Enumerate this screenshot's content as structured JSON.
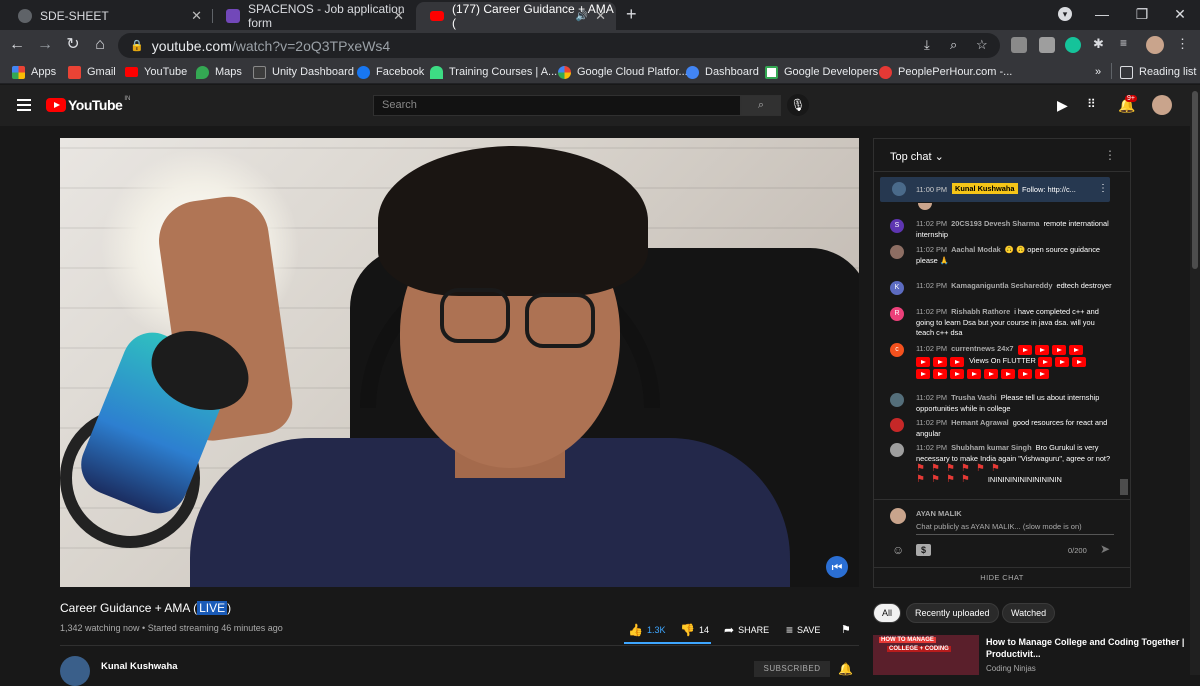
{
  "browser": {
    "tabs": [
      {
        "title": "SDE-SHEET",
        "active": false
      },
      {
        "title": "SPACENOS - Job application form",
        "active": false
      },
      {
        "title": "(177) Career Guidance + AMA (",
        "active": true
      }
    ],
    "url_host": "youtube.com",
    "url_path": "/watch?v=2oQ3TPxeWs4",
    "bookmarks": [
      "Apps",
      "Gmail",
      "YouTube",
      "Maps",
      "Unity Dashboard",
      "Facebook",
      "Training Courses | A...",
      "Google Cloud Platfor...",
      "Dashboard",
      "Google Developers",
      "PeoplePerHour.com -..."
    ],
    "more_bookmarks": "»",
    "reading_list": "Reading list"
  },
  "youtube": {
    "logo_text": "YouTube",
    "country_code": "IN",
    "search_placeholder": "Search",
    "notifications": "9+"
  },
  "video": {
    "title_prefix": "Career Guidance + AMA (",
    "title_live": "LIVE",
    "title_suffix": ")",
    "meta": "1,342 watching now • Started streaming 46 minutes ago",
    "likes": "1.3K",
    "dislikes": "14",
    "share_label": "SHARE",
    "save_label": "SAVE",
    "channel_name": "Kunal Kushwaha",
    "subscribed_label": "SUBSCRIBED"
  },
  "chat": {
    "title": "Top chat",
    "pinned": {
      "time": "11:00 PM",
      "author": "Kunal Kushwaha",
      "text": "Follow: http://c..."
    },
    "messages": [
      {
        "time": "11:02 PM",
        "author": "20CS193 Devesh Sharma",
        "text": "remote international internship",
        "avatar": "S",
        "color": "#5e35b1"
      },
      {
        "time": "11:02 PM",
        "author": "Aachal Modak",
        "text": "🙃 🙃 open source guidance please 🙏",
        "avatar": "",
        "color": "#8d6e63"
      },
      {
        "time": "11:02 PM",
        "author": "Kamaganiguntla Seshareddy",
        "text": "edtech destroyer",
        "avatar": "K",
        "color": "#5c6bc0"
      },
      {
        "time": "11:02 PM",
        "author": "Rishabh Rathore",
        "text": "i have completed c++ and going to learn Dsa but your course in java dsa. will you teach c++ dsa",
        "avatar": "R",
        "color": "#ec407a"
      },
      {
        "time": "11:02 PM",
        "author": "currentnews 24x7",
        "text": "Views On FLUTTER",
        "avatar": "c",
        "color": "#f4511e"
      },
      {
        "time": "11:02 PM",
        "author": "Trusha Vashi",
        "text": "Please tell us about internship opportunities while in college",
        "avatar": "",
        "color": "#546e7a"
      },
      {
        "time": "11:02 PM",
        "author": "Hemant Agrawal",
        "text": "good resources for react and angular",
        "avatar": "",
        "color": "#c62828"
      },
      {
        "time": "11:02 PM",
        "author": "Shubham kumar Singh",
        "text": "Bro Gurukul is very necessary to make India again \"Vishwaguru\", agree or not?",
        "avatar": "",
        "color": "#9e9e9e"
      }
    ],
    "trailing_text": "ININININININININININ",
    "input_user": "AYAN MALIK",
    "input_placeholder": "Chat publicly as AYAN MALIK... (slow mode is on)",
    "char_count": "0/200",
    "hide_chat": "HIDE CHAT"
  },
  "recommendations": {
    "chips": [
      "All",
      "Recently uploaded",
      "Watched"
    ],
    "first": {
      "thumb_label": "HOW TO MANAGE",
      "thumb_sub": "COLLEGE + CODING",
      "title": "How to Manage College and Coding Together | Productivit...",
      "channel": "Coding Ninjas"
    }
  }
}
